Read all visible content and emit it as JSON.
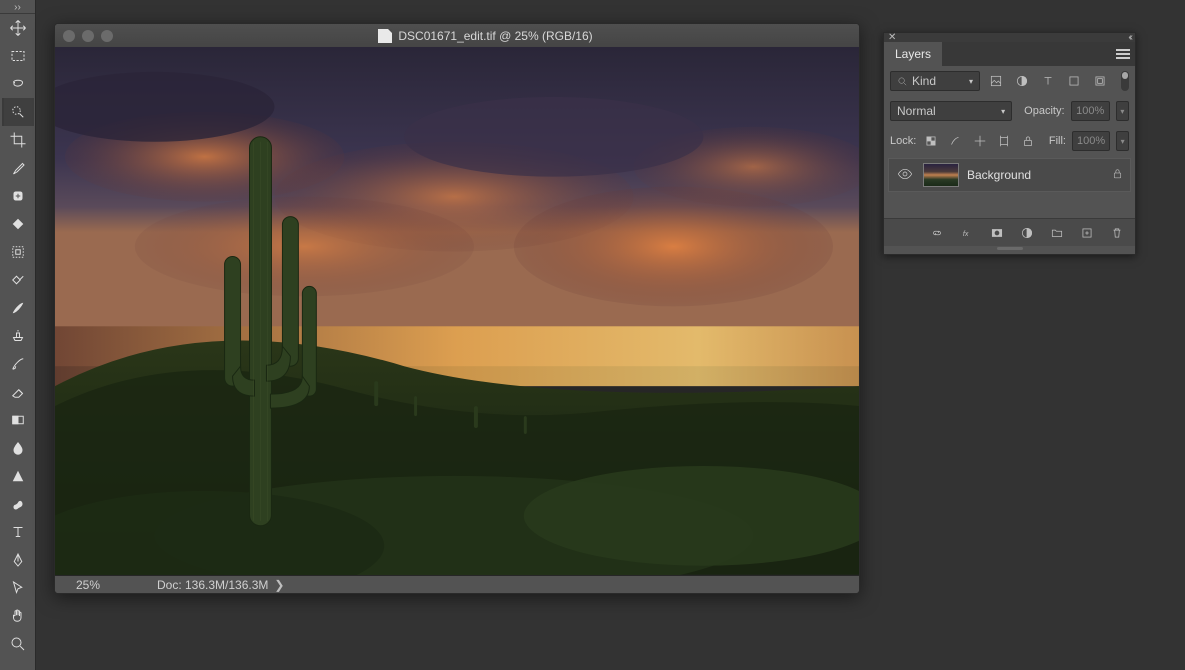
{
  "toolbox": {
    "tools": [
      "move",
      "rectangular-marquee",
      "lasso",
      "quick-selection",
      "crop",
      "eyedropper",
      "spot-healing",
      "patch",
      "content-aware",
      "sharpen",
      "brush",
      "clone-stamp",
      "history-brush",
      "eraser",
      "gradient",
      "pen-curvature",
      "triangle",
      "smudge",
      "type",
      "path-selection",
      "direct-selection",
      "hand",
      "zoom"
    ],
    "selected_index": 3
  },
  "document": {
    "title": "DSC01671_edit.tif @ 25% (RGB/16)",
    "zoom": "25%",
    "status": "Doc: 136.3M/136.3M"
  },
  "layers_panel": {
    "tab": "Layers",
    "filter_label": "Kind",
    "blend_mode": "Normal",
    "opacity_label": "Opacity:",
    "opacity_value": "100%",
    "lock_label": "Lock:",
    "fill_label": "Fill:",
    "fill_value": "100%",
    "layer_name": "Background"
  }
}
